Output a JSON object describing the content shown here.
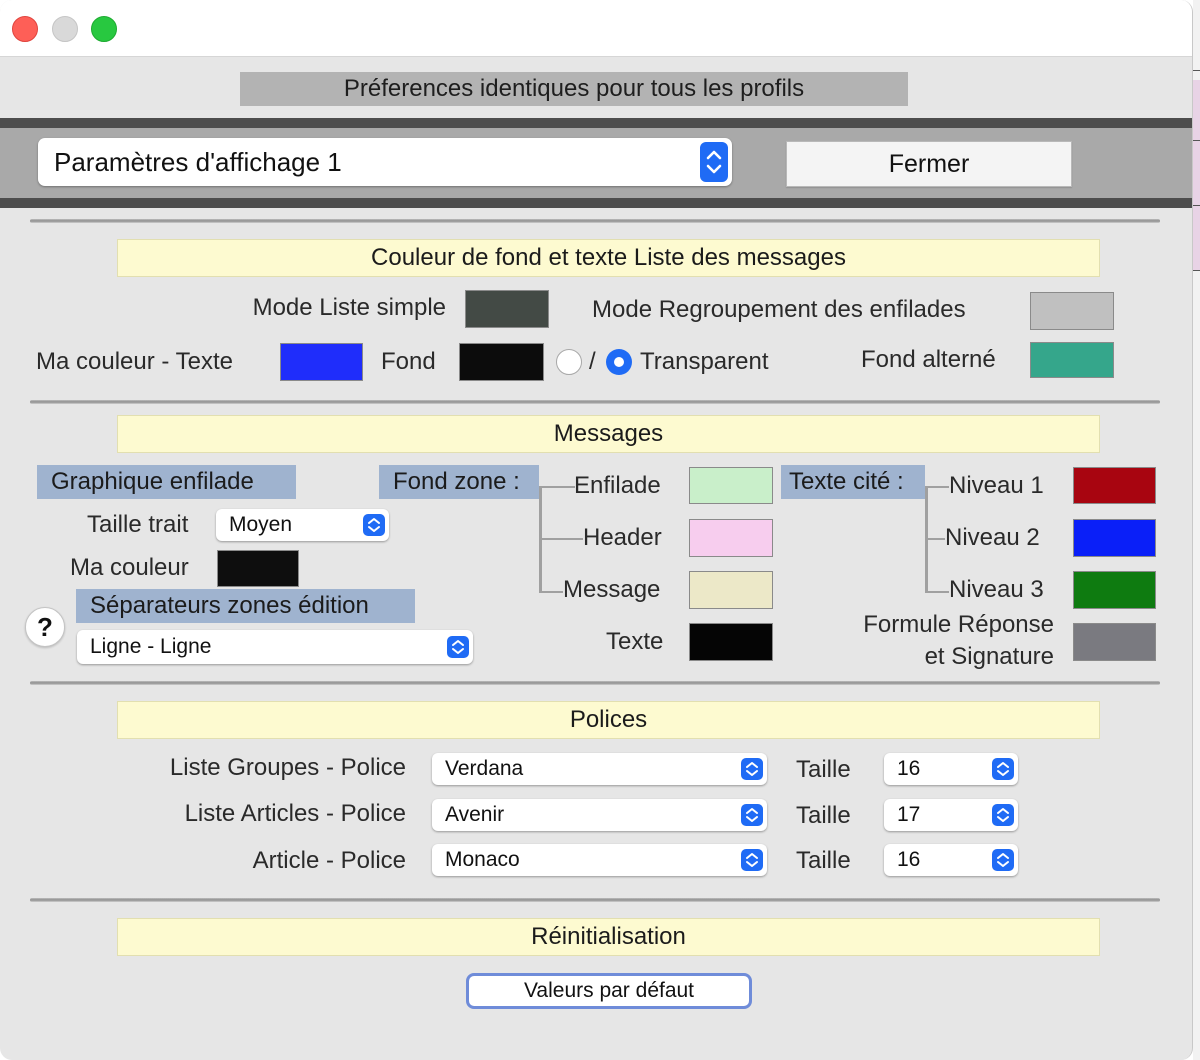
{
  "top_banner": "Préferences identiques pour tous les profils",
  "toolbar": {
    "settings_popup_value": "Paramètres d'affichage 1",
    "close_button": "Fermer"
  },
  "section_colors": {
    "header": "Couleur de fond et texte Liste des messages",
    "simple_list_mode_label": "Mode Liste simple",
    "thread_grouping_mode_label": "Mode Regroupement des enfilades",
    "my_color_text_label": "Ma couleur - Texte",
    "background_label": "Fond",
    "slash": "/",
    "transparent_label": "Transparent",
    "alternate_background_label": "Fond alterné",
    "colors": {
      "simple_list": "#434a45",
      "thread_grouping": "#c0c0c0",
      "my_color_text": "#1f2dfb",
      "background": "#0c0c0c",
      "alternate_background": "#35a68b"
    }
  },
  "section_messages": {
    "header": "Messages",
    "thread_graphic_label": "Graphique enfilade",
    "line_size_label": "Taille trait",
    "line_size_value": "Moyen",
    "my_color_label": "Ma couleur",
    "editing_separators_label": "Séparateurs zones édition",
    "editing_separators_value": "Ligne - Ligne",
    "help_button": "?",
    "zone_background_label": "Fond zone :",
    "zone_thread_label": "Enfilade",
    "zone_header_label": "Header",
    "zone_message_label": "Message",
    "zone_text_label": "Texte",
    "quoted_text_label": "Texte cité :",
    "level1_label": "Niveau 1",
    "level2_label": "Niveau 2",
    "level3_label": "Niveau 3",
    "reply_signature_line1": "Formule Réponse",
    "reply_signature_line2": "et Signature",
    "colors": {
      "my_color": "#0e0e0e",
      "zone_thread": "#c9efca",
      "zone_header": "#f7cdee",
      "zone_message": "#ece8c8",
      "zone_text": "#050505",
      "level1": "#a80510",
      "level2": "#0a1ff8",
      "level3": "#0e7b10",
      "reply_signature": "#7a7a80"
    }
  },
  "section_fonts": {
    "header": "Polices",
    "rows": [
      {
        "label": "Liste Groupes - Police",
        "font": "Verdana",
        "size_label": "Taille",
        "size": "16"
      },
      {
        "label": "Liste Articles - Police",
        "font": "Avenir",
        "size_label": "Taille",
        "size": "17"
      },
      {
        "label": "Article - Police",
        "font": "Monaco",
        "size_label": "Taille",
        "size": "16"
      }
    ]
  },
  "section_reset": {
    "header": "Réinitialisation",
    "defaults_button": "Valeurs par défaut"
  },
  "accent_color": "#1f6bf5"
}
